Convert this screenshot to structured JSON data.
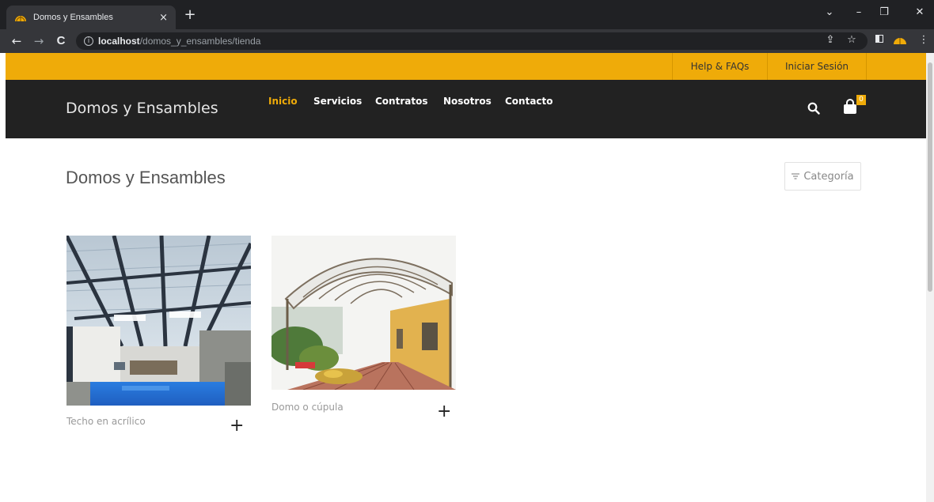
{
  "browser": {
    "tab_title": "Domos y Ensambles",
    "tab_close": "×",
    "new_tab": "+",
    "url_host": "localhost",
    "url_path": "/domos_y_ensambles/tienda",
    "info_icon": "i",
    "back": "←",
    "forward": "→",
    "reload": "C",
    "share": "⇪",
    "star": "☆",
    "menu": "⋮",
    "minimize": "–",
    "maximize": "❐",
    "close": "✕",
    "chevron": "⌄"
  },
  "topbar": {
    "help_label": "Help & FAQs",
    "login_label": "Iniciar Sesión"
  },
  "header": {
    "brand": "Domos y Ensambles",
    "nav": [
      "Inicio",
      "Servicios",
      "Contratos",
      "Nosotros",
      "Contacto"
    ],
    "cart_count": "0"
  },
  "main": {
    "title": "Domos y Ensambles",
    "category_label": "Categoría",
    "products": [
      {
        "name": "Techo en acrílico",
        "add": "+"
      },
      {
        "name": "Domo o cúpula",
        "add": "+"
      }
    ]
  },
  "colors": {
    "accent": "#efab09",
    "header_bg": "#222222"
  }
}
